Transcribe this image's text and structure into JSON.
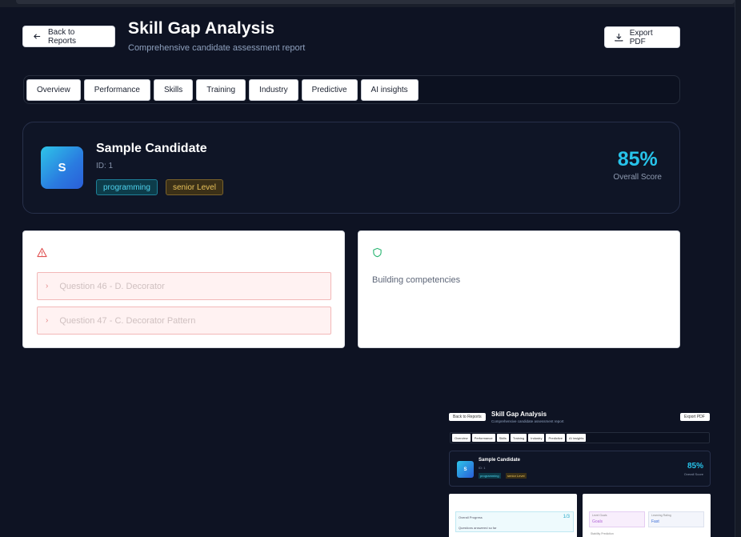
{
  "header": {
    "back_label": "Back to Reports",
    "title": "Skill Gap Analysis",
    "subtitle": "Comprehensive candidate assessment report",
    "export_label": "Export PDF"
  },
  "tabs": [
    "Overview",
    "Performance",
    "Skills",
    "Training",
    "Industry",
    "Predictive",
    "AI insights"
  ],
  "candidate": {
    "avatar_letter": "S",
    "name": "Sample Candidate",
    "id": "ID: 1",
    "skill_badge": "programming",
    "level_badge": "senior Level",
    "score": "85%",
    "score_label": "Overall Score"
  },
  "weakness_panel": {
    "icon": "warning-triangle-icon",
    "items": [
      "Question 46 - D. Decorator",
      "Question 47 - C. Decorator Pattern"
    ]
  },
  "strength_panel": {
    "icon": "shield-icon",
    "text": "Building competencies"
  },
  "thumbnail": {
    "title": "Skill Gap Analysis",
    "subtitle": "Comprehensive candidate assessment report",
    "back_label": "Back to Reports",
    "export_label": "Export PDF",
    "tabs": [
      "Overview",
      "Performance",
      "Skills",
      "Training",
      "Industry",
      "Predictive",
      "AI insights"
    ],
    "name": "Sample Candidate",
    "id": "ID: 1",
    "skill_badge": "programming",
    "level_badge": "senior Level",
    "score": "85%",
    "score_label": "Overall Score",
    "progress_label": "Overall Progress",
    "progress_value": "1/3",
    "progress_sub": "Questions answered so far",
    "level_label": "Level Goals",
    "level_value": "Goals",
    "learning_label": "Learning Rating",
    "learning_value": "Fast",
    "extra_label": "Stability Prediction"
  },
  "colors": {
    "background": "#0e1323",
    "accent": "#27c3ea",
    "skill_badge": "#4fd3ee",
    "level_badge": "#e9c25a",
    "danger": "#e05252",
    "success": "#2bb673"
  }
}
